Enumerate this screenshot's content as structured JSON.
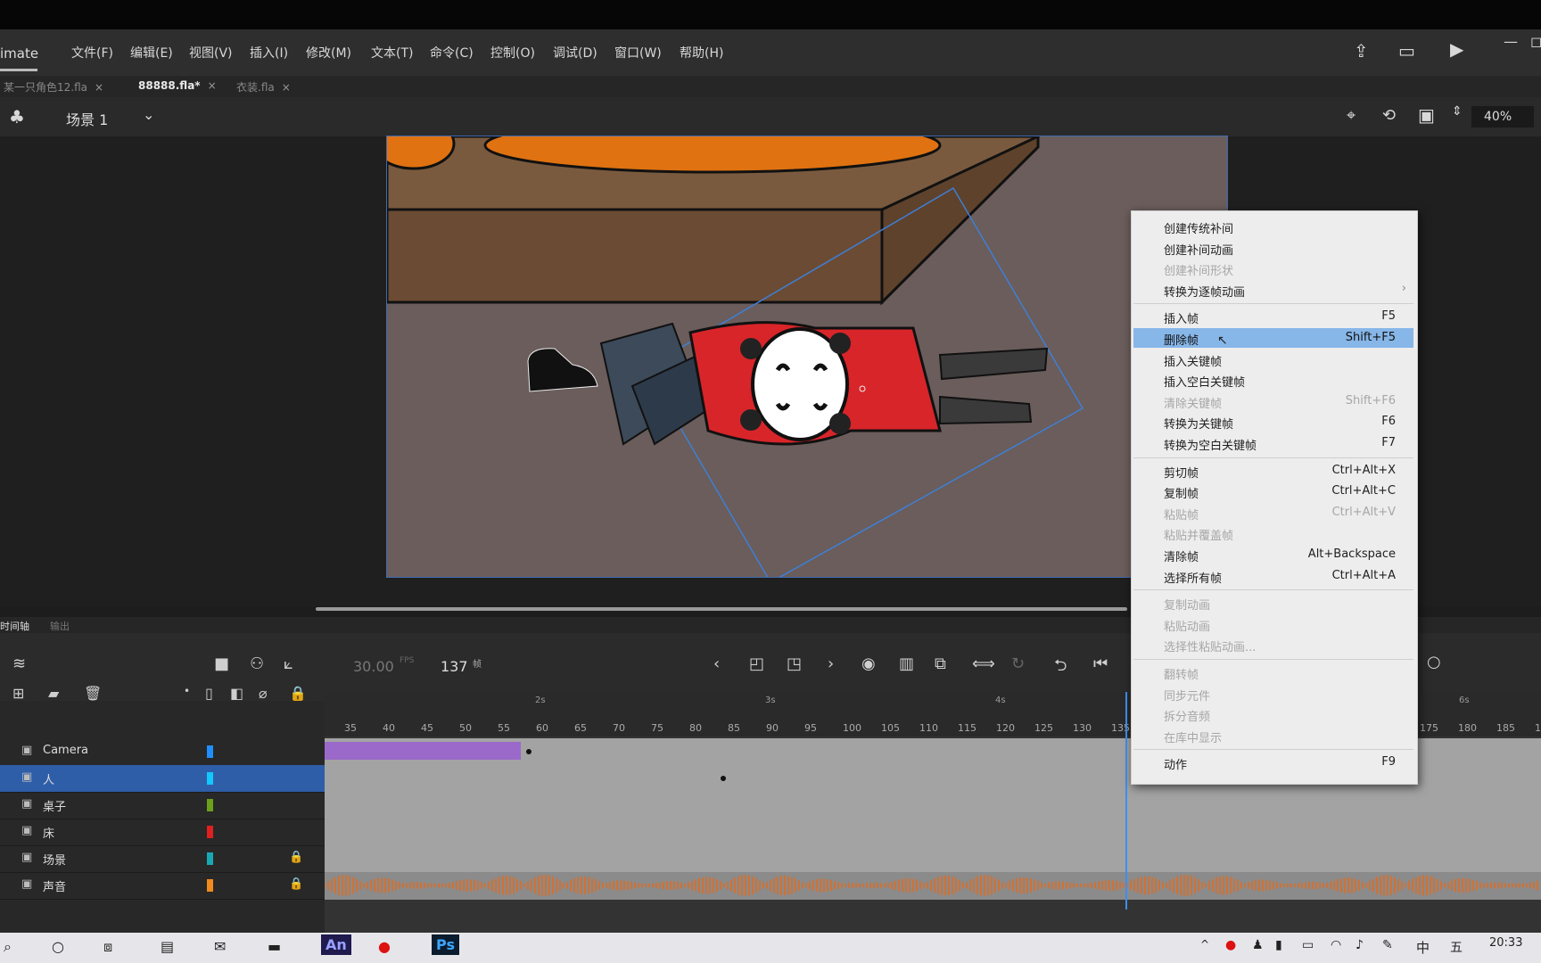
{
  "app": {
    "brand": "imate"
  },
  "menubar": {
    "items": [
      "文件(F)",
      "编辑(E)",
      "视图(V)",
      "插入(I)",
      "修改(M)",
      "文本(T)",
      "命令(C)",
      "控制(O)",
      "调试(D)",
      "窗口(W)",
      "帮助(H)"
    ]
  },
  "doc_tabs": [
    {
      "label": "某一只角色12.fla",
      "active": false
    },
    {
      "label": "88888.fla*",
      "active": true
    },
    {
      "label": "衣装.fla",
      "active": false
    }
  ],
  "scene": {
    "label": "场景 1",
    "zoom": "40%"
  },
  "context_menu": {
    "items": [
      {
        "label": "创建传统补间",
        "shortcut": "",
        "disabled": false
      },
      {
        "label": "创建补间动画",
        "shortcut": "",
        "disabled": false
      },
      {
        "label": "创建补间形状",
        "shortcut": "",
        "disabled": true
      },
      {
        "label": "转换为逐帧动画",
        "shortcut": "",
        "disabled": false,
        "submenu": true
      },
      {
        "label": "插入帧",
        "shortcut": "F5",
        "disabled": false
      },
      {
        "label": "删除帧",
        "shortcut": "Shift+F5",
        "disabled": false,
        "highlighted": true
      },
      {
        "label": "插入关键帧",
        "shortcut": "",
        "disabled": false
      },
      {
        "label": "插入空白关键帧",
        "shortcut": "",
        "disabled": false
      },
      {
        "label": "清除关键帧",
        "shortcut": "Shift+F6",
        "disabled": true
      },
      {
        "label": "转换为关键帧",
        "shortcut": "F6",
        "disabled": false
      },
      {
        "label": "转换为空白关键帧",
        "shortcut": "F7",
        "disabled": false
      },
      {
        "label": "剪切帧",
        "shortcut": "Ctrl+Alt+X",
        "disabled": false
      },
      {
        "label": "复制帧",
        "shortcut": "Ctrl+Alt+C",
        "disabled": false
      },
      {
        "label": "粘贴帧",
        "shortcut": "Ctrl+Alt+V",
        "disabled": true
      },
      {
        "label": "粘贴并覆盖帧",
        "shortcut": "",
        "disabled": true
      },
      {
        "label": "清除帧",
        "shortcut": "Alt+Backspace",
        "disabled": false
      },
      {
        "label": "选择所有帧",
        "shortcut": "Ctrl+Alt+A",
        "disabled": false
      },
      {
        "label": "复制动画",
        "shortcut": "",
        "disabled": true
      },
      {
        "label": "粘贴动画",
        "shortcut": "",
        "disabled": true
      },
      {
        "label": "选择性粘贴动画...",
        "shortcut": "",
        "disabled": true
      },
      {
        "label": "翻转帧",
        "shortcut": "",
        "disabled": true
      },
      {
        "label": "同步元件",
        "shortcut": "",
        "disabled": true
      },
      {
        "label": "拆分音频",
        "shortcut": "",
        "disabled": true
      },
      {
        "label": "在库中显示",
        "shortcut": "",
        "disabled": true
      },
      {
        "label": "动作",
        "shortcut": "F9",
        "disabled": false
      }
    ]
  },
  "timeline": {
    "tabs": [
      "时间轴",
      "输出"
    ],
    "fps": "30.00",
    "fps_unit": "FPS",
    "frame": "137",
    "frame_unit": "帧",
    "seconds": [
      "2s",
      "3s",
      "4s",
      "6s"
    ],
    "ticks_left": [
      "35",
      "40",
      "45",
      "50",
      "55",
      "60",
      "65",
      "70",
      "75",
      "80",
      "85",
      "90",
      "95",
      "100",
      "105",
      "110",
      "115",
      "120",
      "125",
      "130",
      "135"
    ],
    "ticks_right": [
      "175",
      "180",
      "185",
      "1"
    ],
    "layers": [
      {
        "name": "Camera",
        "color": "#1f8fff",
        "locked": false,
        "selected": false
      },
      {
        "name": "人",
        "color": "#13c8ff",
        "locked": false,
        "selected": true
      },
      {
        "name": "桌子",
        "color": "#6aa01a",
        "locked": false,
        "selected": false
      },
      {
        "name": "床",
        "color": "#e0201e",
        "locked": false,
        "selected": false
      },
      {
        "name": "场景",
        "color": "#18a8b4",
        "locked": true,
        "selected": false
      },
      {
        "name": "声音",
        "color": "#f08a1c",
        "locked": true,
        "selected": false
      }
    ]
  },
  "taskbar": {
    "time": "20:33",
    "ime": "中",
    "apps": [
      "An",
      "Ps"
    ]
  }
}
